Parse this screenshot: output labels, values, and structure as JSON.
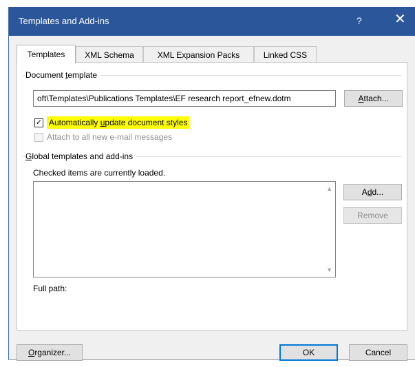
{
  "window": {
    "title": "Templates and Add-ins",
    "help_glyph": "?",
    "close_glyph": "✕"
  },
  "tabs": [
    {
      "label": "Templates",
      "active": true
    },
    {
      "label": "XML Schema",
      "active": false
    },
    {
      "label": "XML Expansion Packs",
      "active": false
    },
    {
      "label": "Linked CSS",
      "active": false
    }
  ],
  "document_template": {
    "group_pre": "Document ",
    "group_key": "t",
    "group_post": "emplate",
    "path_value": "oft\\Templates\\Publications Templates\\EF research report_efnew.dotm",
    "attach_key": "A",
    "attach_rest": "ttach...",
    "auto_update": {
      "checked": true,
      "label_pre": "Automatically ",
      "label_key": "u",
      "label_post": "pdate document styles",
      "check_glyph": "✓"
    },
    "attach_all": {
      "checked": false,
      "enabled": false,
      "label": "Attach to all new e-mail messages"
    }
  },
  "global_templates": {
    "group_key": "G",
    "group_post": "lobal templates and add-ins",
    "hint": "Checked items are currently loaded.",
    "items": [],
    "add_pre": "A",
    "add_key": "d",
    "add_post": "d...",
    "remove_label": "Remove",
    "scroll_up_glyph": "▲",
    "scroll_down_glyph": "▼"
  },
  "full_path": {
    "label": "Full path:"
  },
  "footer": {
    "organizer_key": "O",
    "organizer_rest": "rganizer...",
    "ok_label": "OK",
    "cancel_label": "Cancel"
  },
  "colors": {
    "titlebar": "#2b579a",
    "highlight": "#ffff00",
    "default_button_border": "#0078d7"
  }
}
